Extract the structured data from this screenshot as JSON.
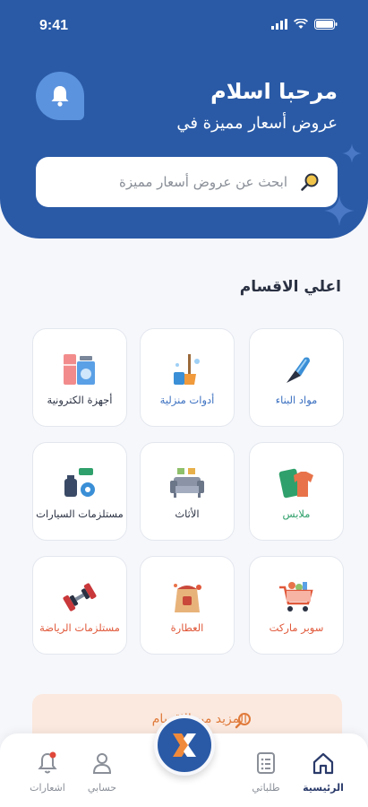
{
  "status": {
    "time": "9:41"
  },
  "header": {
    "greeting": "مرحبا اسلام",
    "subtitle": "عروض أسعار مميزة في"
  },
  "search": {
    "placeholder": "ابحث عن عروض أسعار مميزة"
  },
  "section": {
    "title": "اعلي الاقسام"
  },
  "categories": [
    {
      "label": "مواد البناء",
      "color": "#3a6fc0",
      "icon": "trowel-icon"
    },
    {
      "label": "أدوات منزلية",
      "color": "#3a6fc0",
      "icon": "cleaning-tools-icon"
    },
    {
      "label": "أجهزة الكترونية",
      "color": "#2a3142",
      "icon": "appliances-icon"
    },
    {
      "label": "ملابس",
      "color": "#2fa06b",
      "icon": "clothes-icon"
    },
    {
      "label": "الأثاث",
      "color": "#2a3142",
      "icon": "sofa-icon"
    },
    {
      "label": "مستلزمات السيارات",
      "color": "#2a3142",
      "icon": "car-parts-icon"
    },
    {
      "label": "سوبر ماركت",
      "color": "#e0583a",
      "icon": "shopping-cart-icon"
    },
    {
      "label": "العطارة",
      "color": "#e0583a",
      "icon": "spices-icon"
    },
    {
      "label": "مستلزمات الرياضة",
      "color": "#e0583a",
      "icon": "dumbbell-icon"
    }
  ],
  "banner": {
    "text": "المزيد من الاقسام"
  },
  "nav": {
    "home": "الرئيسية",
    "orders": "طلباتي",
    "account": "حسابي",
    "notifications": "اشعارات"
  },
  "colors": {
    "primary": "#2a5aa6",
    "accent": "#e07a3a",
    "background": "#f6f7fb"
  }
}
